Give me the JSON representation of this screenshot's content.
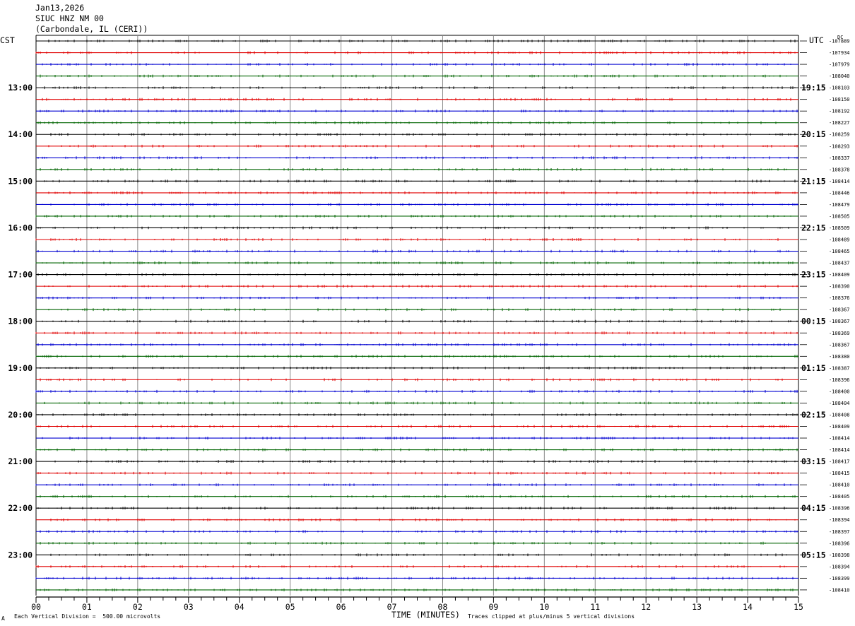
{
  "header": {
    "date": "Jan13,2026",
    "station": "SIUC HNZ NM 00",
    "location": "(Carbondale, IL (CERI))"
  },
  "left_tz": "CST",
  "right_tz": "UTC",
  "dc_label": "DC",
  "footer": {
    "mark": "A",
    "scale_note": "Each Vertical Division =  500.00 microvolts",
    "clip_note": "Traces clipped at plus/minus 5 vertical divisions"
  },
  "chart_data": {
    "type": "line",
    "title": "",
    "xlabel": "TIME (MINUTES)",
    "x_ticks": [
      "00",
      "01",
      "02",
      "03",
      "04",
      "05",
      "06",
      "07",
      "08",
      "09",
      "10",
      "11",
      "12",
      "13",
      "14",
      "15"
    ],
    "xlim": [
      0,
      15
    ],
    "trace_colors": [
      "#000000",
      "#e00000",
      "#0000d0",
      "#006400"
    ],
    "left_hour_labels": [
      "13:00",
      "14:00",
      "15:00",
      "16:00",
      "17:00",
      "18:00",
      "19:00",
      "20:00",
      "21:00",
      "22:00",
      "23:00"
    ],
    "right_hour_labels": [
      "19:15",
      "20:15",
      "21:15",
      "22:15",
      "23:15",
      "00:15",
      "01:15",
      "02:15",
      "03:15",
      "04:15",
      "05:15"
    ],
    "first_labeled_trace": 4,
    "dc_offsets": [
      -107889,
      -107934,
      -107979,
      -108040,
      -108103,
      -108150,
      -108192,
      -108227,
      -108259,
      -108293,
      -108337,
      -108378,
      -108414,
      -108446,
      -108479,
      -108505,
      -108509,
      -108489,
      -108465,
      -108437,
      -108409,
      -108390,
      -108376,
      -108367,
      -108367,
      -108369,
      -108367,
      -108380,
      -108387,
      -108396,
      -108400,
      -108404,
      -108408,
      -108409,
      -108414,
      -108414,
      -108417,
      -108415,
      -108410,
      -108405,
      -108396,
      -108394,
      -108397,
      -108396,
      -108398,
      -108394,
      -108399,
      -108410
    ]
  }
}
